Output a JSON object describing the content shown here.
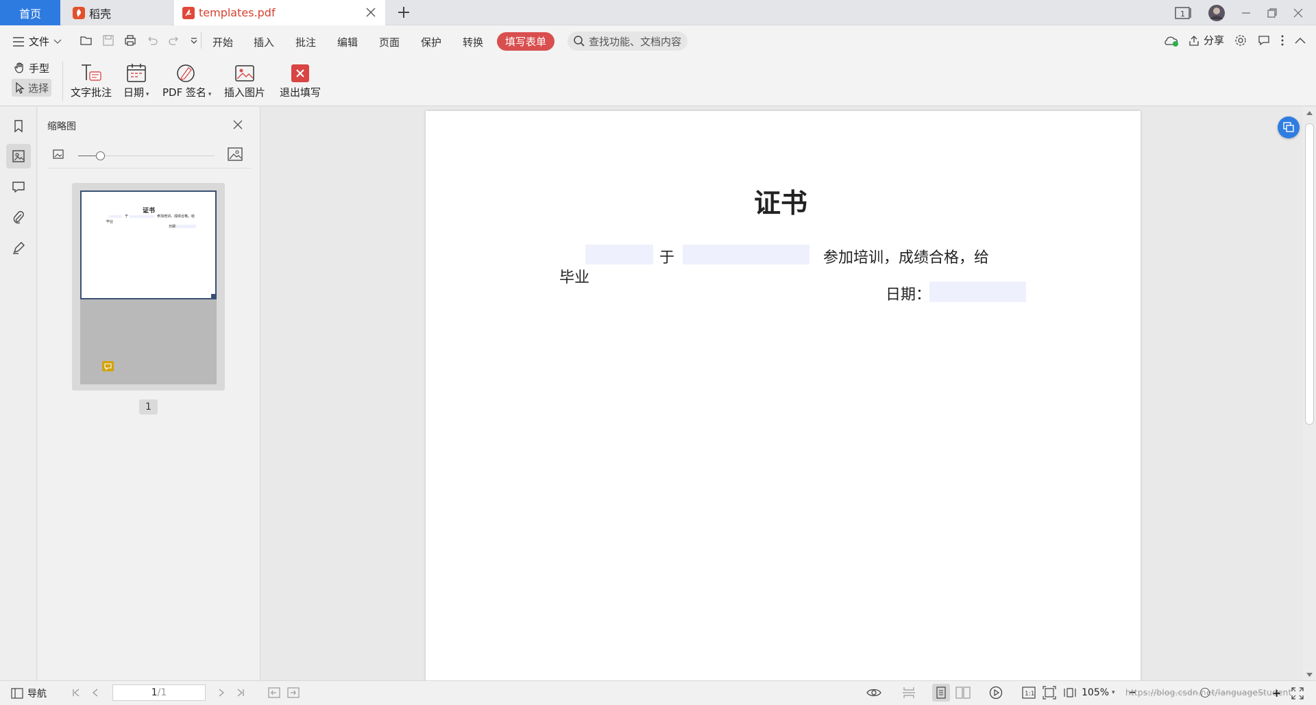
{
  "tabs": {
    "home": "首页",
    "daoke": "稻壳",
    "file": "templates.pdf"
  },
  "menu": {
    "file": "文件",
    "items": [
      "开始",
      "插入",
      "批注",
      "编辑",
      "页面",
      "保护",
      "转换"
    ],
    "fill_form": "填写表单",
    "search_placeholder": "查找功能、文档内容",
    "share": "分享"
  },
  "ribbon": {
    "hand": "手型",
    "select": "选择",
    "text_comment": "文字批注",
    "date": "日期",
    "pdf_sign": "PDF 签名",
    "insert_image": "插入图片",
    "exit_fill": "退出填写"
  },
  "thumbnail_panel": {
    "title": "缩略图",
    "page_number": "1",
    "preview": {
      "title": "证书",
      "yu": "于",
      "line1": "参加培训，成绩合格，给",
      "line2": "毕业",
      "date": "日期："
    }
  },
  "document": {
    "title": "证书",
    "yu": "于",
    "line1_tail": "参加培训，成绩合格，给",
    "line2": "毕业",
    "date_label": "日期："
  },
  "statusbar": {
    "nav": "导航",
    "page_current": "1",
    "page_total": "/1",
    "zoom": "105%",
    "watermark": "https://blog.csdn.net/languageStudent"
  },
  "colors": {
    "tab_active": "#2d7be0",
    "fill_form_accent": "#d94f4f",
    "field_fill": "#eef0fd"
  }
}
